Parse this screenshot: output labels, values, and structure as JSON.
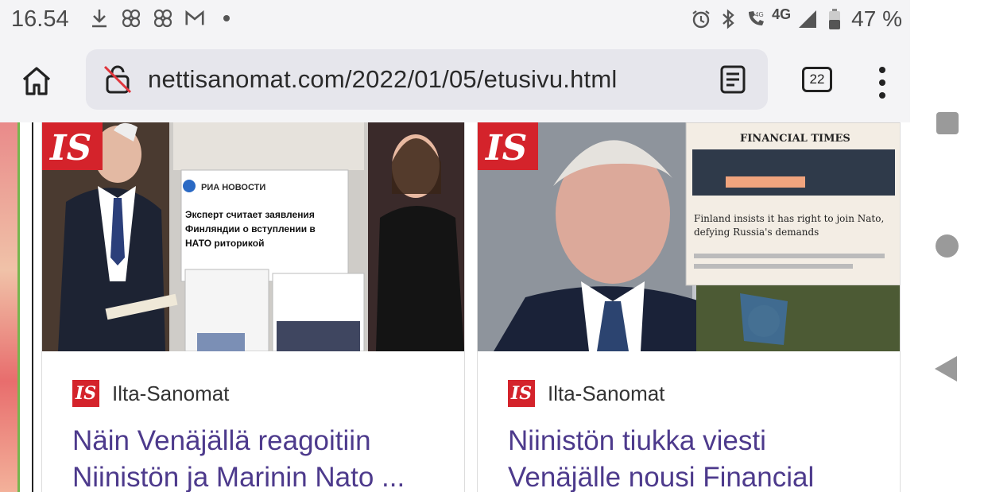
{
  "status_bar": {
    "time": "16.54",
    "network_label": "4G",
    "battery_text": "47 %"
  },
  "browser": {
    "url": "nettisanomat.com/2022/01/05/etusivu.html",
    "tab_count": "22"
  },
  "cards": [
    {
      "image_badge": "IS",
      "source_logo": "IS",
      "source": "Ilta-Sanomat",
      "headline": "Näin Venäjällä reagoitiin Niinistön ja Marinin Nato ..."
    },
    {
      "image_badge": "IS",
      "source_logo": "IS",
      "source": "Ilta-Sanomat",
      "headline": "Niinistön tiukka viesti Venäjälle nousi Financial"
    }
  ],
  "image_texts": {
    "ria": "РИА НОВОСТИ",
    "expert": "Эксперт считает заявления Финляндии о вступлении в НАТО риторикой",
    "ft_title": "FINANCIAL TIMES",
    "ft_headline": "Finland insists it has right to join Nato, defying Russia's demands"
  },
  "colors": {
    "accent_purple": "#4d3a8c",
    "is_red": "#d4232b"
  }
}
